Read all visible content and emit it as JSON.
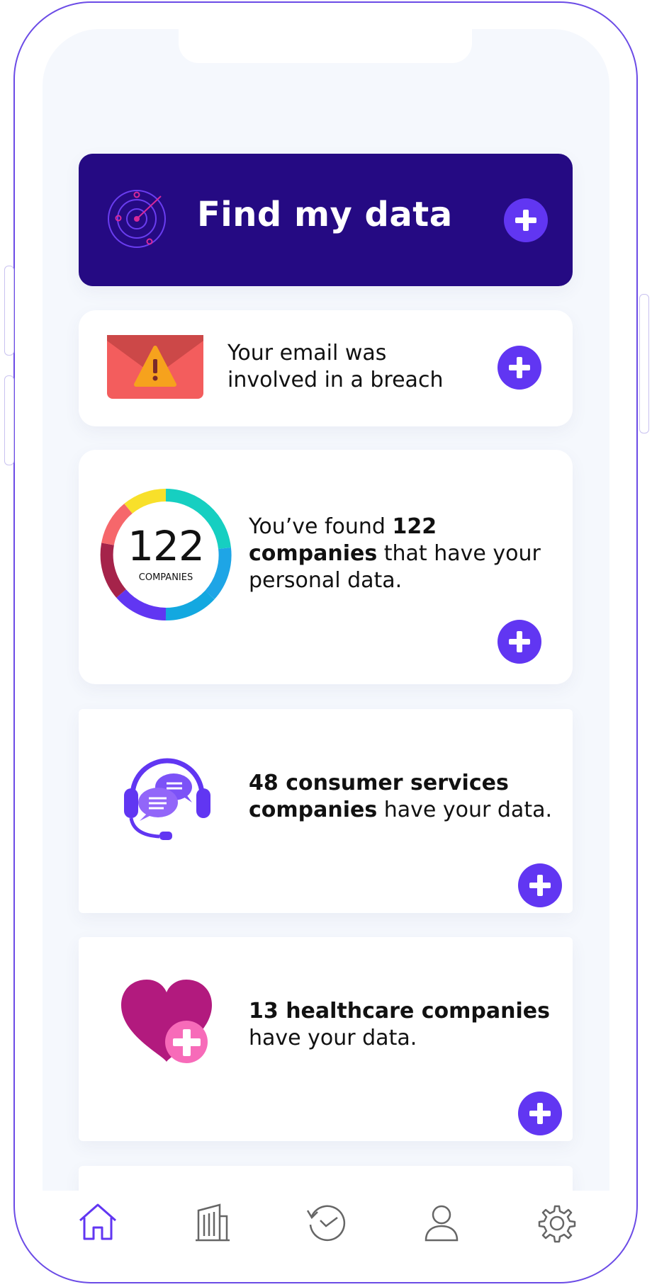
{
  "hero": {
    "title": "Find my data",
    "icon": "radar-icon"
  },
  "cards": [
    {
      "icon": "email-warning-icon",
      "line1": "Your email was",
      "line2": "involved in a breach"
    },
    {
      "icon": "companies-donut-chart",
      "donut_number": "122",
      "donut_label": "COMPANIES",
      "text_a": "You’ve found ",
      "text_b": "122",
      "text_c": "companies",
      "text_d": " that have your",
      "text_e": "personal data."
    },
    {
      "icon": "headset-chat-icon",
      "bold1": "48 consumer services",
      "bold2": "companies",
      "rest2": " have your data."
    },
    {
      "icon": "heart-plus-icon",
      "bold1": "13 healthcare companies",
      "line2": "have your data."
    }
  ],
  "tabbar": {
    "items": [
      "home-icon",
      "building-icon",
      "history-icon",
      "profile-icon",
      "settings-icon"
    ],
    "active": "home-icon"
  },
  "colors": {
    "brand": "#250a83",
    "accent": "#6136f2",
    "background": "#f5f8fd"
  }
}
